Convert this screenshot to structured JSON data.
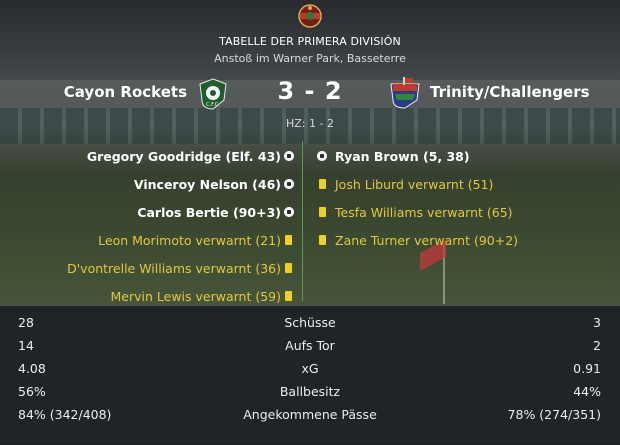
{
  "competition": "TABELLE DER PRIMERA DIVISIÓN",
  "venue": "Anstoß im Warner Park, Basseterre",
  "home": {
    "name": "Cayon Rockets",
    "crest_text": "C.F.C."
  },
  "away": {
    "name": "Trinity/Challengers"
  },
  "score": "3 - 2",
  "halftime": "HZ: 1 - 2",
  "home_events": [
    {
      "text": "Gregory Goodridge (Elf. 43)",
      "type": "goal"
    },
    {
      "text": "Vinceroy Nelson (46)",
      "type": "goal"
    },
    {
      "text": "Carlos Bertie (90+3)",
      "type": "goal"
    },
    {
      "text": "Leon Morimoto verwarnt (21)",
      "type": "yellow-card"
    },
    {
      "text": "D'vontrelle Williams verwarnt (36)",
      "type": "yellow-card"
    },
    {
      "text": "Mervin Lewis verwarnt (59)",
      "type": "yellow-card"
    }
  ],
  "away_events": [
    {
      "text": "Ryan Brown (5, 38)",
      "type": "goal"
    },
    {
      "text": "Josh Liburd verwarnt (51)",
      "type": "yellow-card"
    },
    {
      "text": "Tesfa Williams verwarnt (65)",
      "type": "yellow-card"
    },
    {
      "text": "Zane Turner verwarnt (90+2)",
      "type": "yellow-card"
    }
  ],
  "stats": [
    {
      "label": "Schüsse",
      "home": "28",
      "away": "3"
    },
    {
      "label": "Aufs Tor",
      "home": "14",
      "away": "2"
    },
    {
      "label": "xG",
      "home": "4.08",
      "away": "0.91"
    },
    {
      "label": "Ballbesitz",
      "home": "56%",
      "away": "44%"
    },
    {
      "label": "Angekommene Pässe",
      "home": "84% (342/408)",
      "away": "78% (274/351)"
    }
  ],
  "colors": {
    "goal_text": "#ffffff",
    "card_text": "#e2c93b",
    "yellow_card": "#f0d21e",
    "divider": "#5a9e4a"
  },
  "icons": {
    "goal": "football-icon",
    "card": "yellow-card-icon"
  }
}
